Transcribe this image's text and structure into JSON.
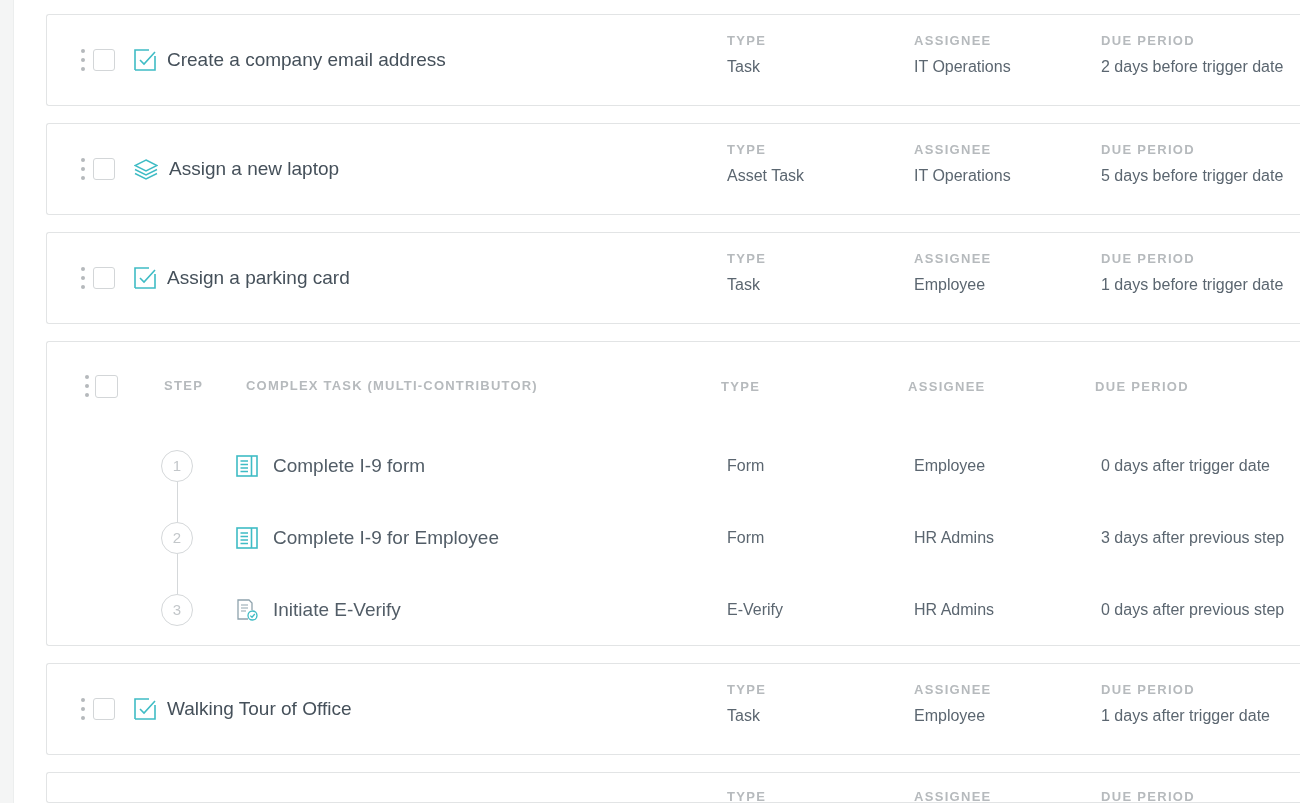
{
  "tasks": [
    {
      "kind": "task",
      "checked": false,
      "title": "Create a company email address",
      "fields": [
        {
          "label": "TYPE",
          "value": "Task"
        },
        {
          "label": "ASSIGNEE",
          "value": "IT Operations"
        },
        {
          "label": "DUE PERIOD",
          "value": "2 days before trigger date"
        }
      ]
    },
    {
      "kind": "asset",
      "checked": false,
      "title": "Assign a new laptop",
      "fields": [
        {
          "label": "TYPE",
          "value": "Asset Task"
        },
        {
          "label": "ASSIGNEE",
          "value": "IT Operations"
        },
        {
          "label": "DUE PERIOD",
          "value": "5 days before trigger date"
        }
      ]
    },
    {
      "kind": "task",
      "checked": false,
      "title": "Assign a parking card",
      "fields": [
        {
          "label": "TYPE",
          "value": "Task"
        },
        {
          "label": "ASSIGNEE",
          "value": "Employee"
        },
        {
          "label": "DUE PERIOD",
          "value": "1 days before trigger date"
        }
      ]
    },
    {
      "kind": "complex",
      "checked": false,
      "columns": [
        "STEP",
        "COMPLEX TASK (MULTI-CONTRIBUTOR)",
        "TYPE",
        "ASSIGNEE",
        "DUE PERIOD"
      ],
      "steps": [
        {
          "number": "1",
          "kind": "form",
          "title": "Complete I-9 form",
          "type": "Form",
          "assignee": "Employee",
          "due_period": "0 days after trigger date"
        },
        {
          "number": "2",
          "kind": "form",
          "title": "Complete I-9 for Employee",
          "type": "Form",
          "assignee": "HR Admins",
          "due_period": "3 days after previous step"
        },
        {
          "number": "3",
          "kind": "verify",
          "title": "Initiate E-Verify",
          "type": "E-Verify",
          "assignee": "HR Admins",
          "due_period": "0 days after previous step"
        }
      ]
    },
    {
      "kind": "task",
      "checked": false,
      "title": "Walking Tour of Office",
      "fields": [
        {
          "label": "TYPE",
          "value": "Task"
        },
        {
          "label": "ASSIGNEE",
          "value": "Employee"
        },
        {
          "label": "DUE PERIOD",
          "value": "1 days after trigger date"
        }
      ]
    },
    {
      "fields": [
        {
          "label": "TYPE"
        },
        {
          "label": "ASSIGNEE"
        },
        {
          "label": "DUE PERIOD"
        }
      ]
    }
  ]
}
